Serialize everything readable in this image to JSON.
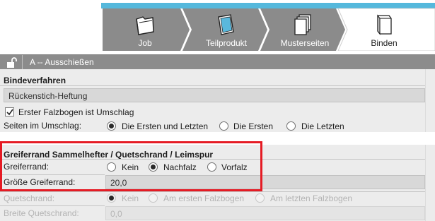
{
  "tabs": [
    {
      "label": "Job",
      "icon": "job-folder-icon",
      "active": false
    },
    {
      "label": "Teilprodukt",
      "icon": "sheet-icon",
      "active": false
    },
    {
      "label": "Musterseiten",
      "icon": "pages-stack-icon",
      "active": false
    },
    {
      "label": "Binden",
      "icon": "book-binding-icon",
      "active": true
    }
  ],
  "section": {
    "title": "A -- Ausschießen",
    "lock_icon": "unlock-icon"
  },
  "binding": {
    "heading": "Bindeverfahren",
    "method_value": "Rückenstich-Heftung",
    "first_fold_checkbox_label": "Erster Falzbogen ist Umschlag",
    "first_fold_checked": true,
    "cover_pages_label": "Seiten im Umschlag:",
    "cover_pages_options": [
      "Die Ersten und Letzten",
      "Die Ersten",
      "Die Letzten"
    ],
    "cover_pages_selected": "Die Ersten und Letzten"
  },
  "gripper": {
    "heading": "Greiferrand Sammelhefter / Quetschrand / Leimspur",
    "gripper_label": "Greiferrand:",
    "gripper_options": [
      "Kein",
      "Nachfalz",
      "Vorfalz"
    ],
    "gripper_selected": "Nachfalz",
    "gripper_size_label": "Größe Greiferrand:",
    "gripper_size_value": "20,0",
    "quetsch_label": "Quetschrand:",
    "quetsch_options": [
      "Kein",
      "Am ersten Falzbogen",
      "Am letzten Falzbogen"
    ],
    "quetsch_selected": "Kein",
    "quetsch_width_label": "Breite Quetschrand:",
    "quetsch_width_value": "0,0"
  },
  "colors": {
    "accent_cyan": "#55b8dc",
    "tab_gray": "#8b8b8b",
    "highlight_red": "#e51b24",
    "panel_bg": "#ececec"
  }
}
